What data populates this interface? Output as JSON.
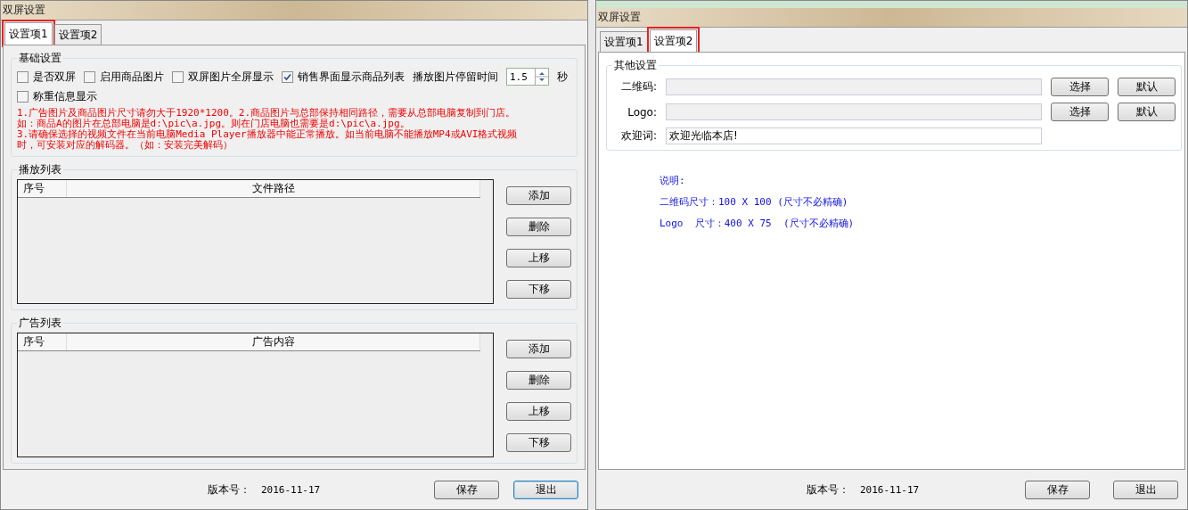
{
  "left_window": {
    "title": "双屏设置",
    "tabs": [
      {
        "label": "设置项1",
        "selected": true,
        "highlighted": true
      },
      {
        "label": "设置项2",
        "selected": false,
        "highlighted": false
      }
    ],
    "basic": {
      "title": "基础设置",
      "checkboxes": [
        {
          "label": "是否双屏",
          "checked": false
        },
        {
          "label": "启用商品图片",
          "checked": false
        },
        {
          "label": "双屏图片全屏显示",
          "checked": false
        },
        {
          "label": "销售界面显示商品列表",
          "checked": true
        },
        {
          "label": "称重信息显示",
          "checked": false
        }
      ],
      "stay_label": "播放图片停留时间",
      "stay_value": "1.5",
      "stay_unit": "秒",
      "notes": [
        "1.广告图片及商品图片尺寸请勿大于1920*1200。2.商品图片与总部保持相同路径，需要从总部电脑复制到门店。",
        "如：商品A的图片在总部电脑是d:\\pic\\a.jpg。则在门店电脑也需要是d:\\pic\\a.jpg。",
        "3.请确保选择的视频文件在当前电脑Media Player播放器中能正常播放。如当前电脑不能播放MP4或AVI格式视频",
        "时，可安装对应的解码器。（如：安装完美解码）"
      ]
    },
    "lists": [
      {
        "title": "播放列表",
        "columns": [
          "序号",
          "文件路径"
        ],
        "buttons": [
          "添加",
          "删除",
          "上移",
          "下移"
        ]
      },
      {
        "title": "广告列表",
        "columns": [
          "序号",
          "广告内容"
        ],
        "buttons": [
          "添加",
          "删除",
          "上移",
          "下移"
        ]
      }
    ],
    "footer": {
      "version_label": "版本号：",
      "version": "2016-11-17",
      "buttons": [
        {
          "label": "保存",
          "default": false
        },
        {
          "label": "退出",
          "default": true
        }
      ]
    }
  },
  "right_window": {
    "title": "双屏设置",
    "tabs": [
      {
        "label": "设置项1",
        "selected": false,
        "highlighted": false
      },
      {
        "label": "设置项2",
        "selected": true,
        "highlighted": true
      }
    ],
    "other": {
      "title": "其他设置",
      "rows": [
        {
          "label": "二维码:",
          "value": "",
          "disabled": true,
          "buttons": [
            "选择",
            "默认"
          ]
        },
        {
          "label": "Logo:",
          "value": "",
          "disabled": true,
          "buttons": [
            "选择",
            "默认"
          ]
        },
        {
          "label": "欢迎词:",
          "value": "欢迎光临本店!",
          "disabled": false,
          "buttons": []
        }
      ]
    },
    "notes": [
      "说明:",
      "二维码尺寸：100 X 100 (尺寸不必精确)",
      "Logo  尺寸：400 X 75  (尺寸不必精确)"
    ],
    "footer": {
      "version_label": "版本号：",
      "version": "2016-11-17",
      "buttons": [
        {
          "label": "保存",
          "default": false
        },
        {
          "label": "退出",
          "default": false
        }
      ]
    }
  }
}
